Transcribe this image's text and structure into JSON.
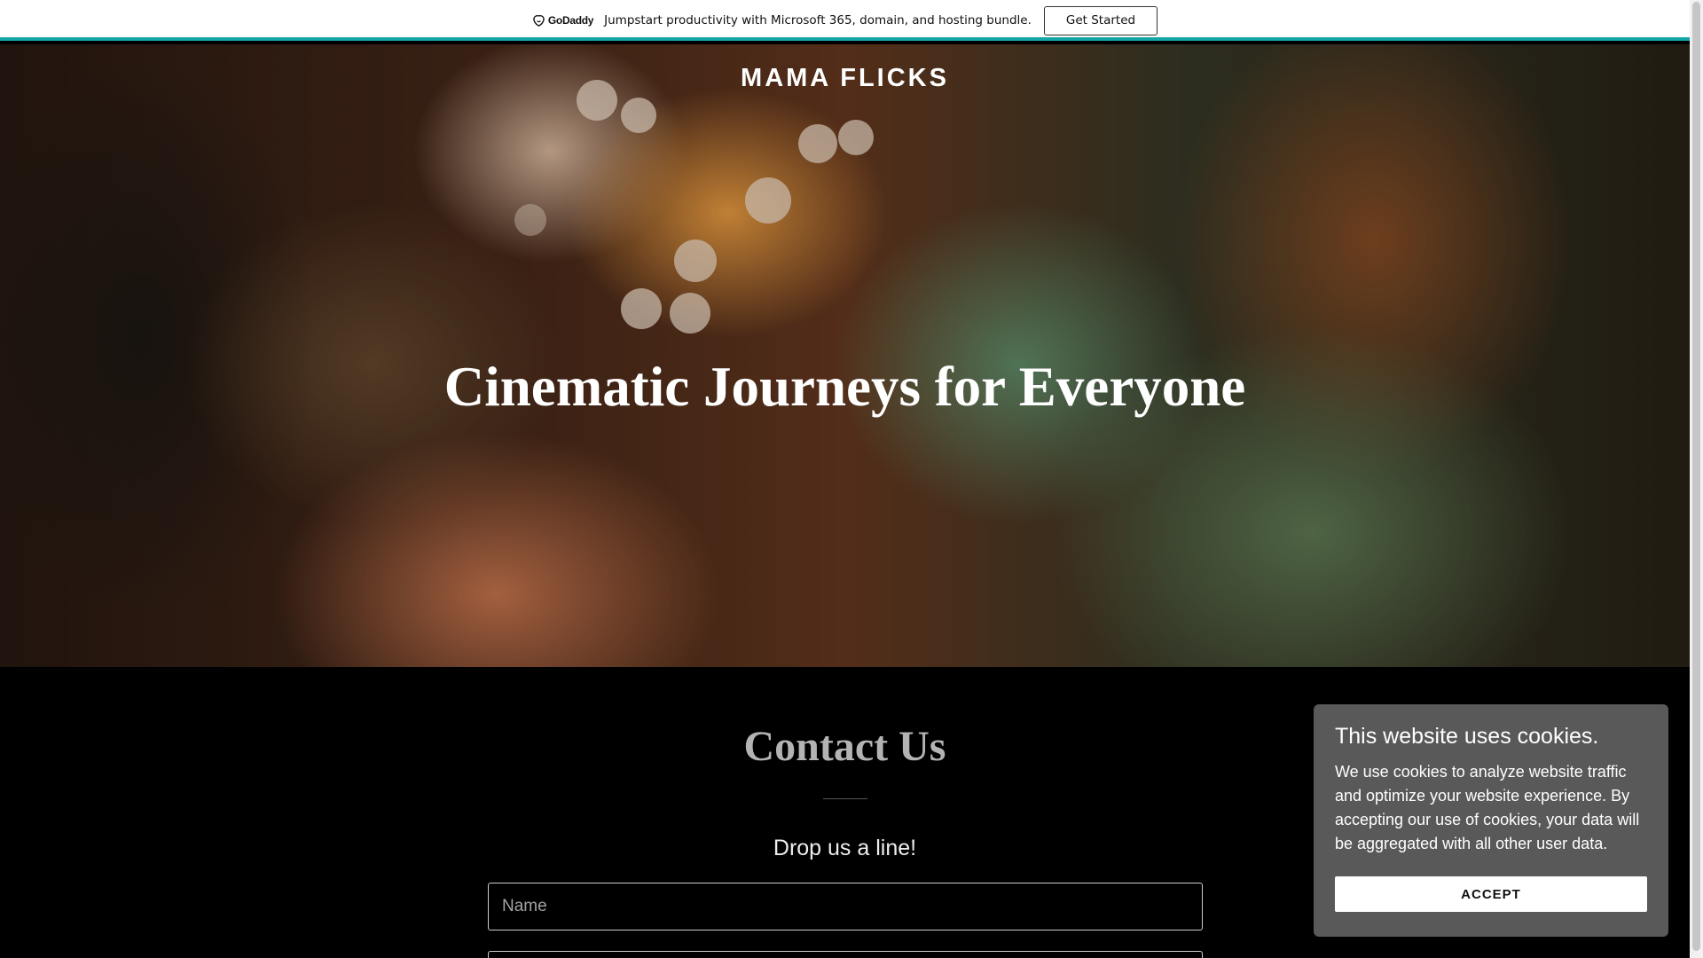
{
  "promo": {
    "logo_text": "GoDaddy",
    "message": "Jumpstart productivity with Microsoft 365, domain, and hosting bundle.",
    "cta_label": "Get Started"
  },
  "hero": {
    "brand": "MAMA FLICKS",
    "title": "Cinematic Journeys for Everyone"
  },
  "contact": {
    "title": "Contact Us",
    "subtitle": "Drop us a line!",
    "name_placeholder": "Name"
  },
  "cookie": {
    "title": "This website uses cookies.",
    "text": "We use cookies to analyze website traffic and optimize your website experience. By accepting our use of cookies, your data will be aggregated with all other user data.",
    "accept_label": "ACCEPT"
  },
  "colors": {
    "promo_accent": "#15a6a6",
    "cookie_bg": "#595959",
    "page_bg": "#000000"
  }
}
